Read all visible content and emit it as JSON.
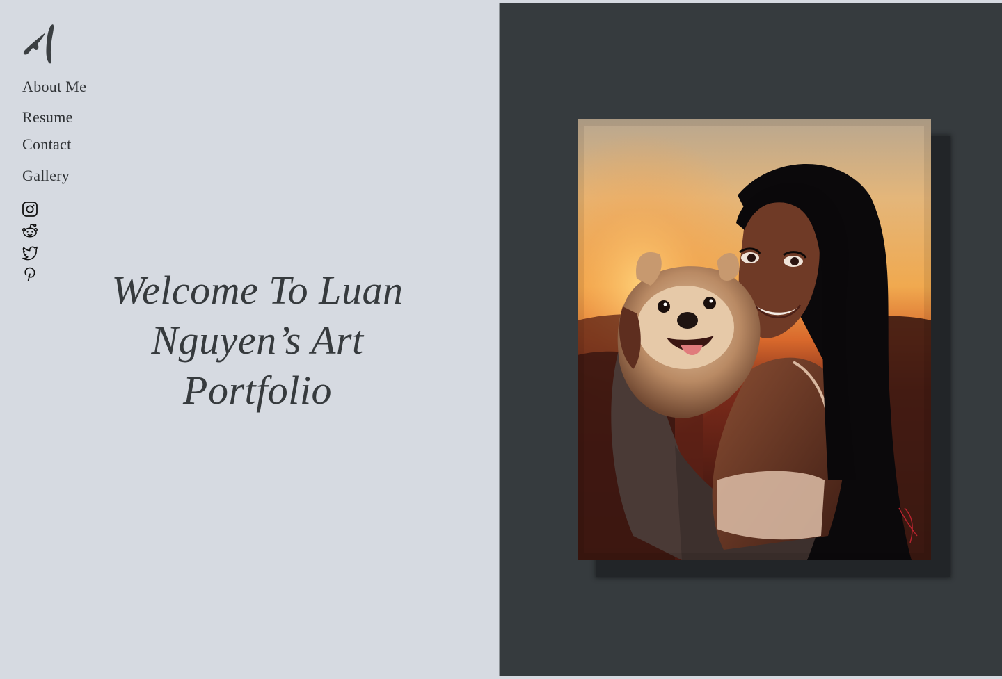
{
  "logo": {
    "icon": "brush-stroke-logo-icon"
  },
  "nav": {
    "items": [
      {
        "label": "About Me"
      },
      {
        "label": "Resume"
      },
      {
        "label": "Contact"
      },
      {
        "label": "Gallery"
      }
    ]
  },
  "socials": [
    {
      "icon": "instagram-icon"
    },
    {
      "icon": "reddit-icon"
    },
    {
      "icon": "twitter-icon"
    },
    {
      "icon": "pinterest-icon"
    }
  ],
  "hero": {
    "title": "Welcome To Luan Nguyen’s Art Portfolio"
  },
  "artwork": {
    "description_icon": "portrait-painting-girl-with-dog"
  },
  "colors": {
    "left_background": "#d6dae1",
    "right_background": "#363b3e",
    "text": "#2f3235"
  }
}
